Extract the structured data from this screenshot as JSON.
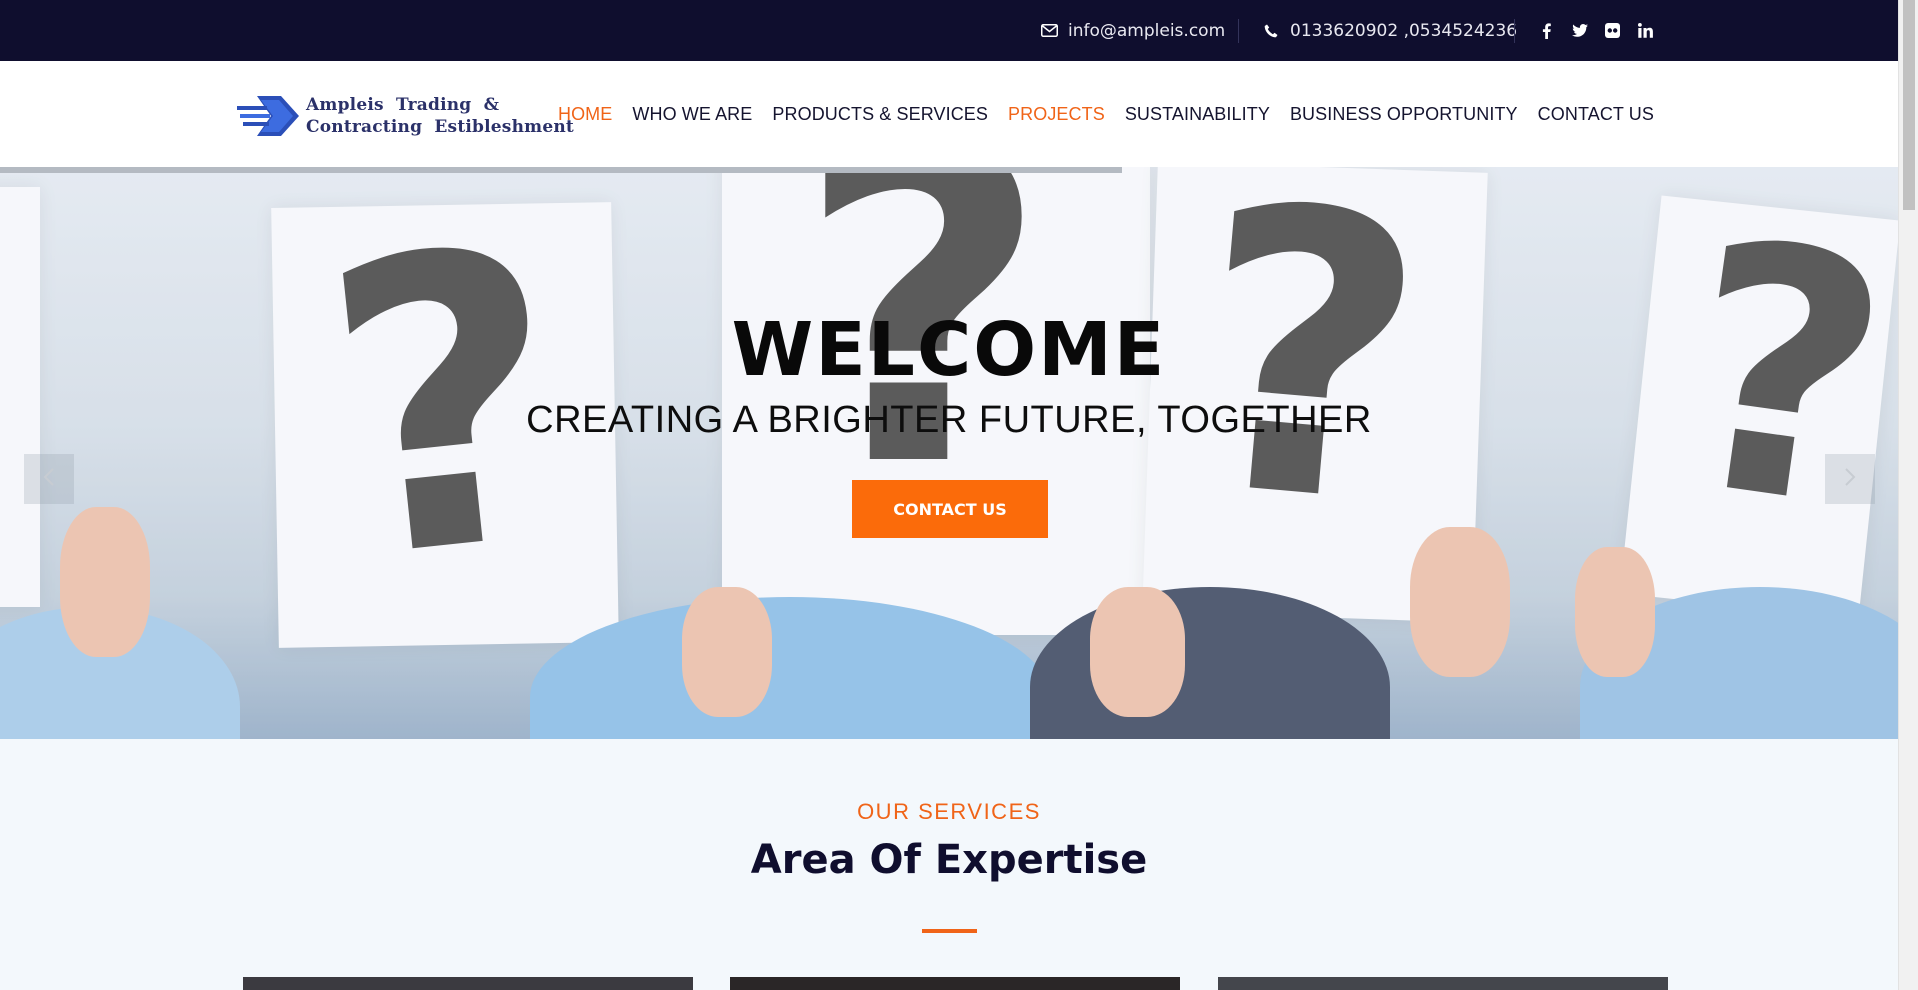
{
  "topbar": {
    "email": "info@ampleis.com",
    "email_icon": "envelope-icon",
    "phone": "0133620902 ,0534524236",
    "phone_icon": "phone-icon",
    "socials": [
      "facebook-icon",
      "twitter-icon",
      "flickr-icon",
      "linkedin-icon"
    ],
    "bg_color": "#0f0e2e"
  },
  "header": {
    "logo_line1": "Ampleis  Trading  &",
    "logo_line2": "Contracting  Estibleshment",
    "nav": [
      {
        "label": "HOME",
        "active": true
      },
      {
        "label": "WHO WE ARE",
        "active": false
      },
      {
        "label": "PRODUCTS & SERVICES",
        "active": false
      },
      {
        "label": "PROJECTS",
        "active": true
      },
      {
        "label": "SUSTAINABILITY",
        "active": false
      },
      {
        "label": "BUSINESS OPPORTUNITY",
        "active": false
      },
      {
        "label": "CONTACT US",
        "active": false
      }
    ]
  },
  "hero": {
    "title": "WELCOME",
    "subtitle": "CREATING A BRIGHTER FUTURE, TOGETHER",
    "button_label": "CONTACT US",
    "prev_icon": "chevron-left-icon",
    "next_icon": "chevron-right-icon"
  },
  "services": {
    "eyebrow": "OUR SERVICES",
    "title": "Area Of Expertise"
  },
  "colors": {
    "accent": "#f06418",
    "button": "#fb6b0a",
    "dark": "#0f0e2e"
  }
}
